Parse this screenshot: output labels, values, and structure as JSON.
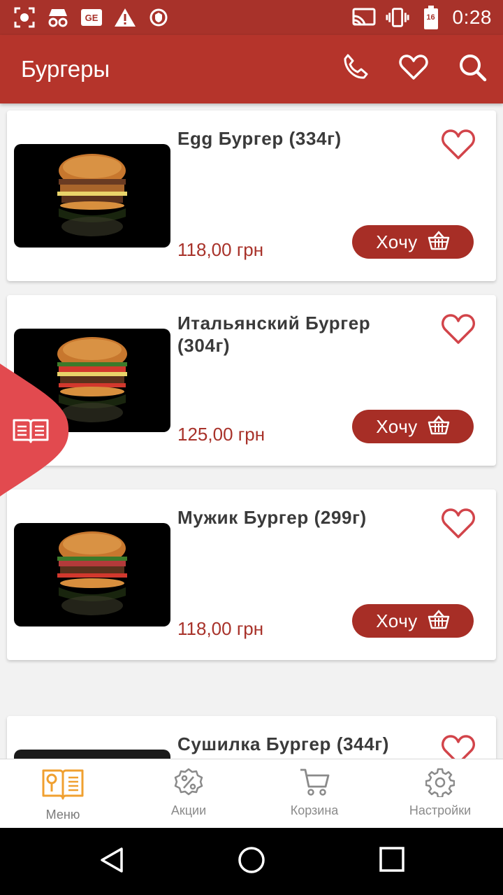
{
  "status_bar": {
    "time": "0:28",
    "battery_level": "16",
    "icons": [
      "screenshot-icon",
      "incognito-icon",
      "ge-icon",
      "warning-icon",
      "vpn-icon",
      "cast-icon",
      "vibrate-icon",
      "battery-icon"
    ]
  },
  "app_bar": {
    "title": "Бургеры",
    "actions": [
      "phone-icon",
      "heart-icon",
      "search-icon"
    ]
  },
  "products": [
    {
      "title": "Egg Бургер (334г)",
      "price": "118,00 грн",
      "button": "Хочу"
    },
    {
      "title": "Итальянский Бургер (304г)",
      "price": "125,00 грн",
      "button": "Хочу"
    },
    {
      "title": "Мужик Бургер (299г)",
      "price": "118,00 грн",
      "button": "Хочу"
    },
    {
      "title": "Сушилка Бургер (344г)",
      "price": "",
      "button": ""
    }
  ],
  "bottom_nav": {
    "items": [
      {
        "label": "Меню",
        "icon": "menu-book-icon",
        "active": true
      },
      {
        "label": "Акции",
        "icon": "discount-icon",
        "active": false
      },
      {
        "label": "Корзина",
        "icon": "cart-icon",
        "active": false
      },
      {
        "label": "Настройки",
        "icon": "gear-icon",
        "active": false
      }
    ]
  },
  "colors": {
    "primary": "#b5342b",
    "status_bar": "#a8322a",
    "button": "#a72e26",
    "price": "#a8322a",
    "heart": "#d2444a",
    "side_tab": "#e24a4f",
    "active_nav": "#f0a030"
  }
}
